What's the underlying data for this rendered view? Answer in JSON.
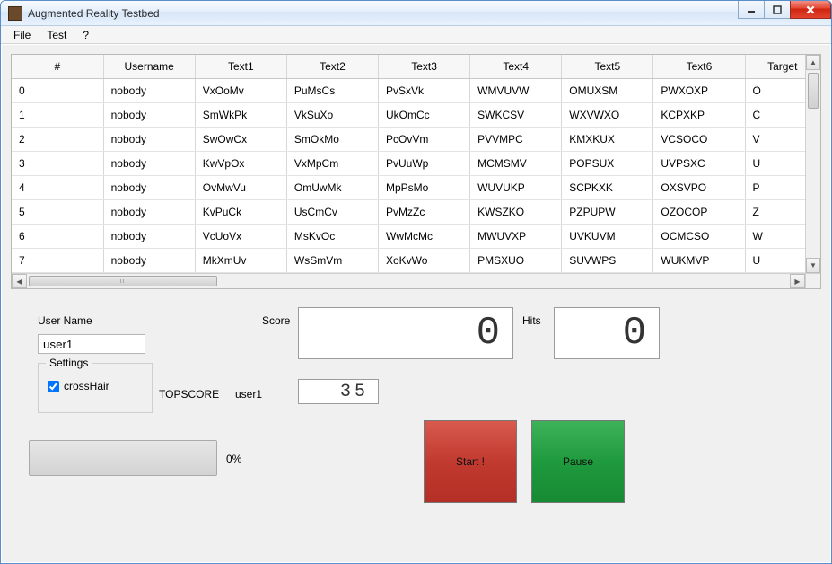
{
  "window": {
    "title": "Augmented Reality Testbed"
  },
  "menu": {
    "file": "File",
    "test": "Test",
    "help": "?"
  },
  "table": {
    "headers": [
      "#",
      "Username",
      "Text1",
      "Text2",
      "Text3",
      "Text4",
      "Text5",
      "Text6",
      "Target"
    ],
    "rows": [
      [
        "0",
        "nobody",
        "VxOoMv",
        "PuMsCs",
        "PvSxVk",
        "WMVUVW",
        "OMUXSM",
        "PWXOXP",
        "O"
      ],
      [
        "1",
        "nobody",
        "SmWkPk",
        "VkSuXo",
        "UkOmCc",
        "SWKCSV",
        "WXVWXO",
        "KCPXKP",
        "C"
      ],
      [
        "2",
        "nobody",
        "SwOwCx",
        "SmOkMo",
        "PcOvVm",
        "PVVMPC",
        "KMXKUX",
        "VCSOCO",
        "V"
      ],
      [
        "3",
        "nobody",
        "KwVpOx",
        "VxMpCm",
        "PvUuWp",
        "MCMSMV",
        "POPSUX",
        "UVPSXC",
        "U"
      ],
      [
        "4",
        "nobody",
        "OvMwVu",
        "OmUwMk",
        "MpPsMo",
        "WUVUKP",
        "SCPKXK",
        "OXSVPO",
        "P"
      ],
      [
        "5",
        "nobody",
        "KvPuCk",
        "UsCmCv",
        "PvMzZc",
        "KWSZKO",
        "PZPUPW",
        "OZOCOP",
        "Z"
      ],
      [
        "6",
        "nobody",
        "VcUoVx",
        "MsKvOc",
        "WwMcMc",
        "MWUVXP",
        "UVKUVM",
        "OCMCSO",
        "W"
      ],
      [
        "7",
        "nobody",
        "MkXmUv",
        "WsSmVm",
        "XoKvWo",
        "PMSXUO",
        "SUVWPS",
        "WUKMVP",
        "U"
      ]
    ]
  },
  "form": {
    "username_label": "User Name",
    "username_value": "user1",
    "settings_legend": "Settings",
    "crosshair_label": "crossHair",
    "crosshair_checked": true,
    "topscore_label": "TOPSCORE",
    "topscore_user": "user1",
    "score_label": "Score",
    "score_value": "0",
    "hits_label": "Hits",
    "hits_value": "0",
    "topscore_value": "35",
    "progress_text": "0%",
    "start_label": "Start !",
    "pause_label": "Pause"
  }
}
